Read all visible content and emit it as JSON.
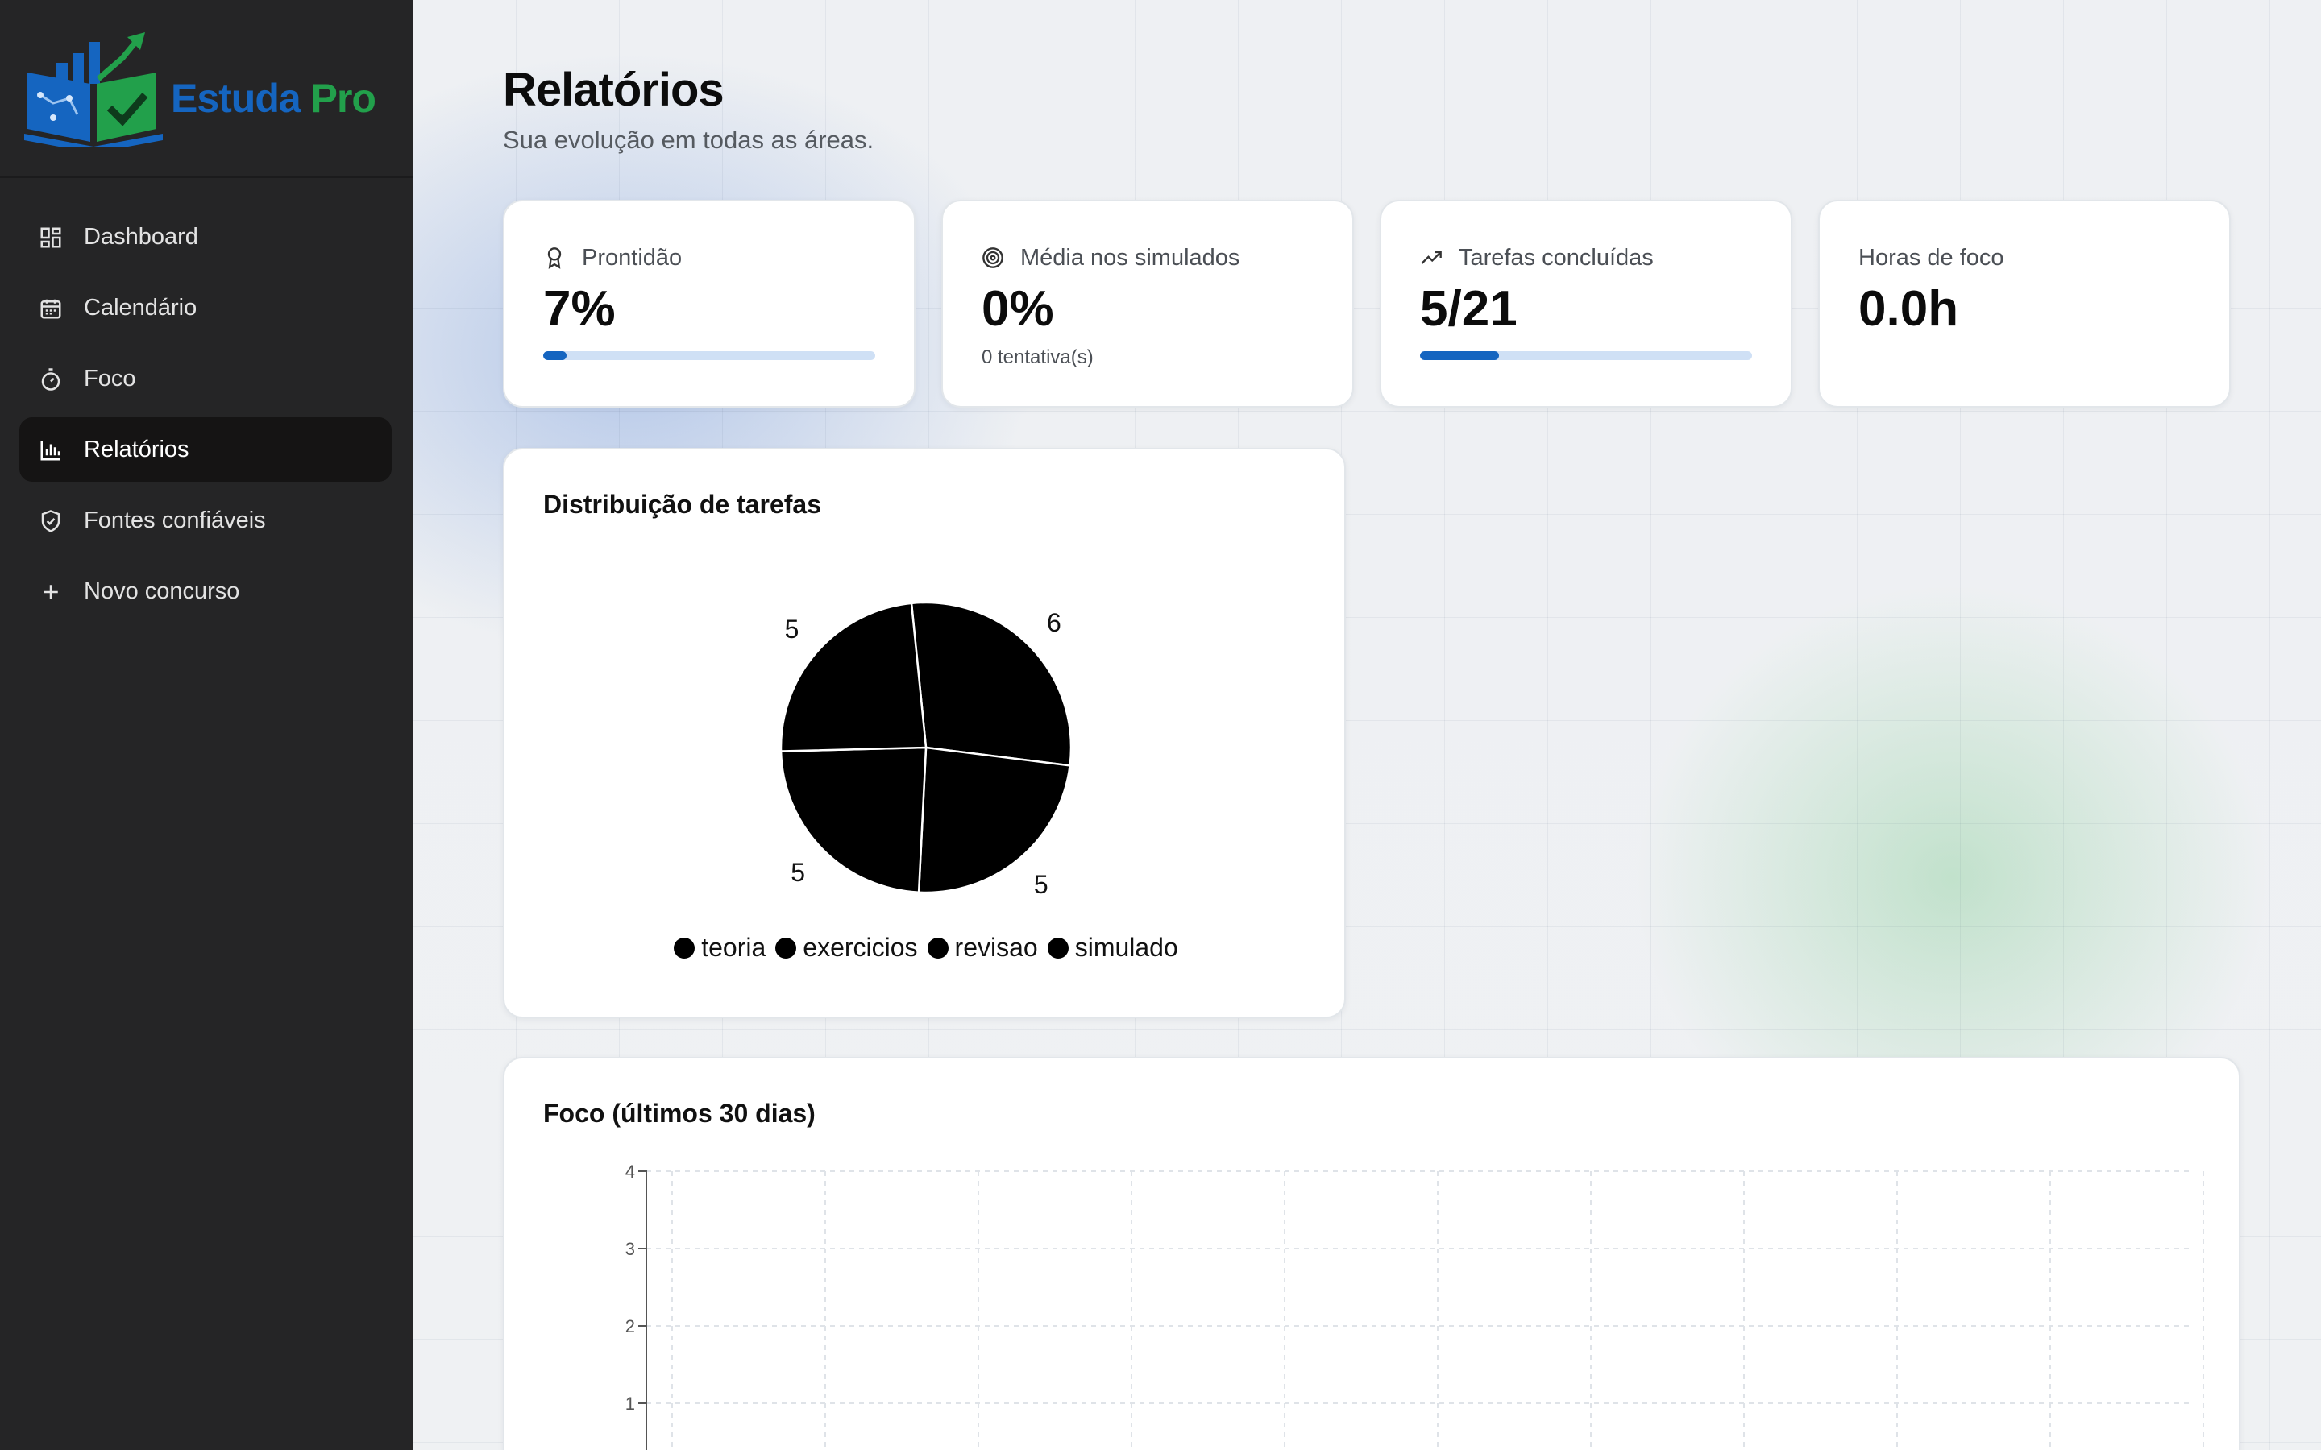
{
  "brand": {
    "name_part1": "Estuda",
    "name_part2": "Pro"
  },
  "sidebar": {
    "items": [
      {
        "label": "Dashboard",
        "icon": "dashboard-icon",
        "active": false
      },
      {
        "label": "Calendário",
        "icon": "calendar-icon",
        "active": false
      },
      {
        "label": "Foco",
        "icon": "timer-icon",
        "active": false
      },
      {
        "label": "Relatórios",
        "icon": "bar-chart-icon",
        "active": true
      },
      {
        "label": "Fontes confiáveis",
        "icon": "shield-check-icon",
        "active": false
      },
      {
        "label": "Novo concurso",
        "icon": "plus-icon",
        "active": false
      }
    ]
  },
  "header": {
    "title": "Relatórios",
    "subtitle": "Sua evolução em todas as áreas."
  },
  "stats": {
    "readiness": {
      "label": "Prontidão",
      "icon": "award-icon",
      "value": "7%",
      "progress": 0.07
    },
    "simulados": {
      "label": "Média nos simulados",
      "icon": "target-icon",
      "value": "0%",
      "sub": "0 tentativa(s)"
    },
    "tasks": {
      "label": "Tarefas concluídas",
      "icon": "trending-up-icon",
      "value": "5/21",
      "progress": 0.238
    },
    "focus_hours": {
      "label": "Horas de foco",
      "value": "0.0h"
    }
  },
  "pie_panel": {
    "title": "Distribuição de tarefas"
  },
  "line_panel": {
    "title": "Foco (últimos 30 dias)"
  },
  "colors": {
    "accent": "#1565c0",
    "brand_green": "#22a04b",
    "sidebar_bg": "#252526"
  },
  "chart_data": [
    {
      "type": "pie",
      "title": "Distribuição de tarefas",
      "categories": [
        "teoria",
        "exercicios",
        "revisao",
        "simulado"
      ],
      "values": [
        6,
        5,
        5,
        5
      ],
      "legend": "bottom"
    },
    {
      "type": "line",
      "title": "Foco (últimos 30 dias)",
      "ylim": [
        0,
        4
      ],
      "yticks": [
        1,
        2,
        3,
        4
      ],
      "grid": true,
      "series": []
    }
  ]
}
